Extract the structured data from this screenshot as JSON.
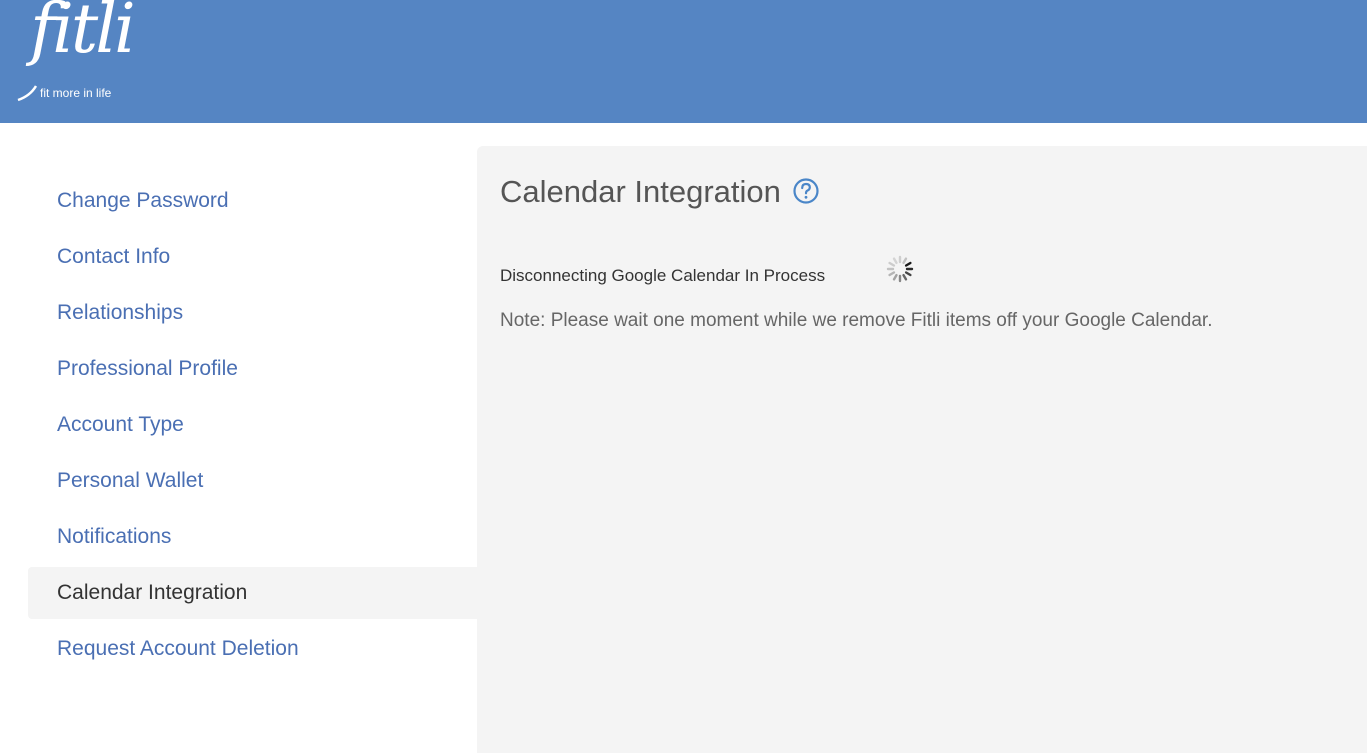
{
  "header": {
    "logo_text": "fitli",
    "logo_tagline": "fit more in life",
    "background_color": "#5585c3"
  },
  "sidebar": {
    "items": [
      {
        "label": "Change Password"
      },
      {
        "label": "Contact Info"
      },
      {
        "label": "Relationships"
      },
      {
        "label": "Professional Profile"
      },
      {
        "label": "Account Type"
      },
      {
        "label": "Personal Wallet"
      },
      {
        "label": "Notifications"
      },
      {
        "label": "Calendar Integration",
        "active": true
      },
      {
        "label": "Request Account Deletion"
      }
    ],
    "link_color": "#4a6fb3"
  },
  "main": {
    "title": "Calendar Integration",
    "help_icon": "question-circle-icon",
    "status": "Disconnecting Google Calendar In Process",
    "loading_icon": "spinner-icon",
    "note": "Note: Please wait one moment while we remove Fitli items off your Google Calendar."
  }
}
